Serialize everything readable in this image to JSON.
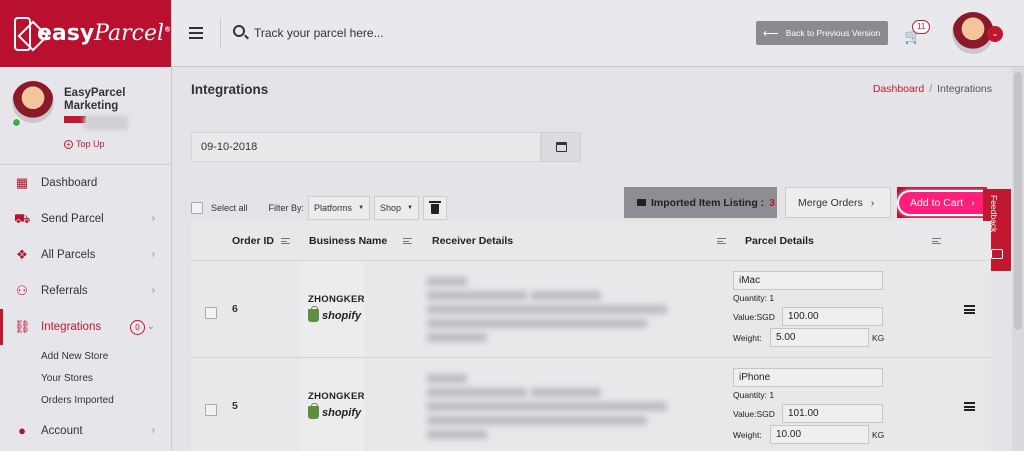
{
  "brand": {
    "logo_text_1": "easy",
    "logo_text_2": "Parcel",
    "reg_mark": "®",
    "color": "#b8102e"
  },
  "profile": {
    "name": "EasyParcel Marketing",
    "topup_label": "Top Up"
  },
  "sidebar": {
    "items": [
      {
        "label": "Dashboard",
        "icon": "dashboard-icon"
      },
      {
        "label": "Send Parcel",
        "icon": "truck-icon"
      },
      {
        "label": "All Parcels",
        "icon": "parcels-icon"
      },
      {
        "label": "Referrals",
        "icon": "referrals-icon"
      },
      {
        "label": "Integrations",
        "icon": "link-icon",
        "badge": "0"
      },
      {
        "label": "Account",
        "icon": "user-icon"
      }
    ],
    "subitems": [
      "Add New Store",
      "Your Stores",
      "Orders Imported"
    ]
  },
  "topbar": {
    "search_placeholder": "Track your parcel here...",
    "back_label": "Back to Previous Version",
    "cart_count": "11"
  },
  "page": {
    "title": "Integrations",
    "breadcrumb": {
      "home": "Dashboard",
      "sep": "/",
      "current": "Integrations"
    }
  },
  "filters": {
    "date_value": "09-10-2018",
    "select_all": "Select all",
    "filter_by": "Filter By:",
    "platforms": "Platforms",
    "shop": "Shop"
  },
  "actions": {
    "imported_label": "Imported Item Listing :",
    "imported_count": "3",
    "merge_label": "Merge Orders",
    "add_cart_label": "Add to Cart",
    "feedback_label": "Feedback"
  },
  "table": {
    "headers": [
      "Order ID",
      "Business Name",
      "Receiver Details",
      "Parcel Details"
    ],
    "rows": [
      {
        "order_id": "6",
        "store": "ZHONGKER",
        "platform": "shopify",
        "item": "iMac",
        "quantity": "Quantity: 1",
        "value_label": "Value:SGD",
        "value": "100.00",
        "weight_label": "Weight:",
        "weight": "5.00",
        "unit": "KG"
      },
      {
        "order_id": "5",
        "store": "ZHONGKER",
        "platform": "shopify",
        "item": "iPhone",
        "quantity": "Quantity: 1",
        "value_label": "Value:SGD",
        "value": "101.00",
        "weight_label": "Weight:",
        "weight": "10.00",
        "unit": "KG"
      }
    ]
  }
}
